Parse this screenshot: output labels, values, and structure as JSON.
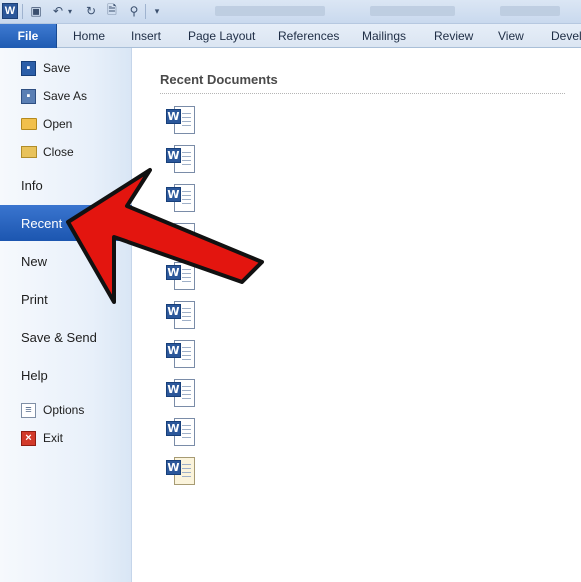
{
  "ribbon": {
    "file_label": "File",
    "tabs": [
      "Home",
      "Insert",
      "Page Layout",
      "References",
      "Mailings",
      "Review",
      "View",
      "Develo"
    ]
  },
  "nav": {
    "small_top": [
      {
        "label": "Save",
        "icon": "save-icon"
      },
      {
        "label": "Save As",
        "icon": "save-as-icon"
      },
      {
        "label": "Open",
        "icon": "open-folder-icon"
      },
      {
        "label": "Close",
        "icon": "close-folder-icon"
      }
    ],
    "big": [
      {
        "label": "Info"
      },
      {
        "label": "Recent",
        "active": true
      },
      {
        "label": "New"
      },
      {
        "label": "Print"
      },
      {
        "label": "Save & Send"
      },
      {
        "label": "Help"
      }
    ],
    "small_bottom": [
      {
        "label": "Options",
        "icon": "options-icon"
      },
      {
        "label": "Exit",
        "icon": "exit-icon"
      }
    ]
  },
  "main": {
    "title": "Recent Documents",
    "document_count": 10
  },
  "colors": {
    "file_tab": "#2b64bf",
    "active_nav": "#2a66c2",
    "annotation_arrow": "#e3150f"
  }
}
